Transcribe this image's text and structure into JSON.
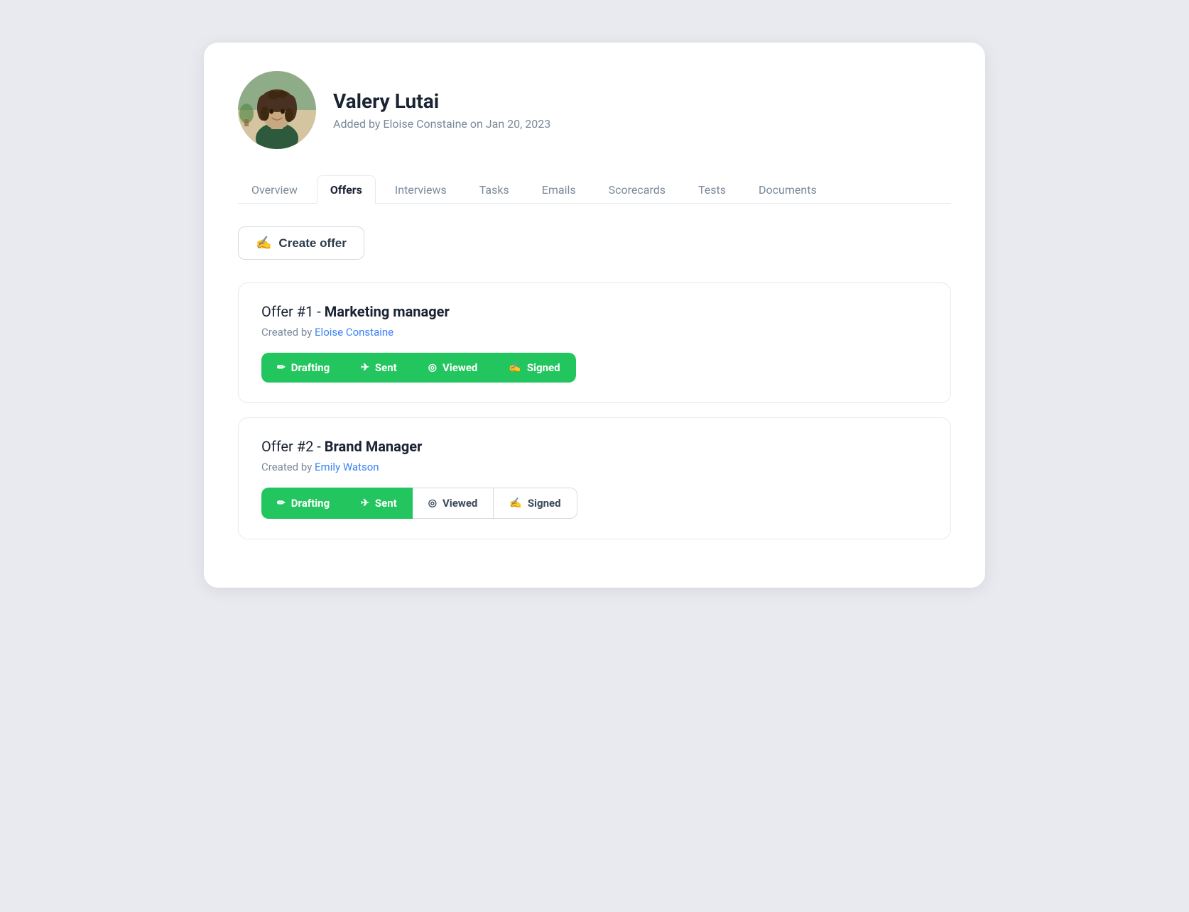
{
  "profile": {
    "name": "Valery Lutai",
    "meta": "Added by Eloise Constaine on Jan 20, 2023",
    "avatar_alt": "Valery Lutai profile photo"
  },
  "tabs": [
    {
      "id": "overview",
      "label": "Overview",
      "active": false
    },
    {
      "id": "offers",
      "label": "Offers",
      "active": true
    },
    {
      "id": "interviews",
      "label": "Interviews",
      "active": false
    },
    {
      "id": "tasks",
      "label": "Tasks",
      "active": false
    },
    {
      "id": "emails",
      "label": "Emails",
      "active": false
    },
    {
      "id": "scorecards",
      "label": "Scorecards",
      "active": false
    },
    {
      "id": "tests",
      "label": "Tests",
      "active": false
    },
    {
      "id": "documents",
      "label": "Documents",
      "active": false
    }
  ],
  "create_offer_btn": "Create offer",
  "offers": [
    {
      "id": "offer-1",
      "title_prefix": "Offer #1 - ",
      "title_bold": "Marketing manager",
      "created_by_prefix": "Created by ",
      "created_by": "Eloise Constaine",
      "status": [
        {
          "label": "Drafting",
          "active": true,
          "icon": "✏"
        },
        {
          "label": "Sent",
          "active": true,
          "icon": "✈"
        },
        {
          "label": "Viewed",
          "active": true,
          "icon": "◎"
        },
        {
          "label": "Signed",
          "active": true,
          "icon": "✍"
        }
      ]
    },
    {
      "id": "offer-2",
      "title_prefix": "Offer #2 - ",
      "title_bold": "Brand Manager",
      "created_by_prefix": "Created by ",
      "created_by": "Emily Watson",
      "status": [
        {
          "label": "Drafting",
          "active": true,
          "icon": "✏"
        },
        {
          "label": "Sent",
          "active": true,
          "icon": "✈"
        },
        {
          "label": "Viewed",
          "active": false,
          "icon": "◎"
        },
        {
          "label": "Signed",
          "active": false,
          "icon": "✍"
        }
      ]
    }
  ]
}
